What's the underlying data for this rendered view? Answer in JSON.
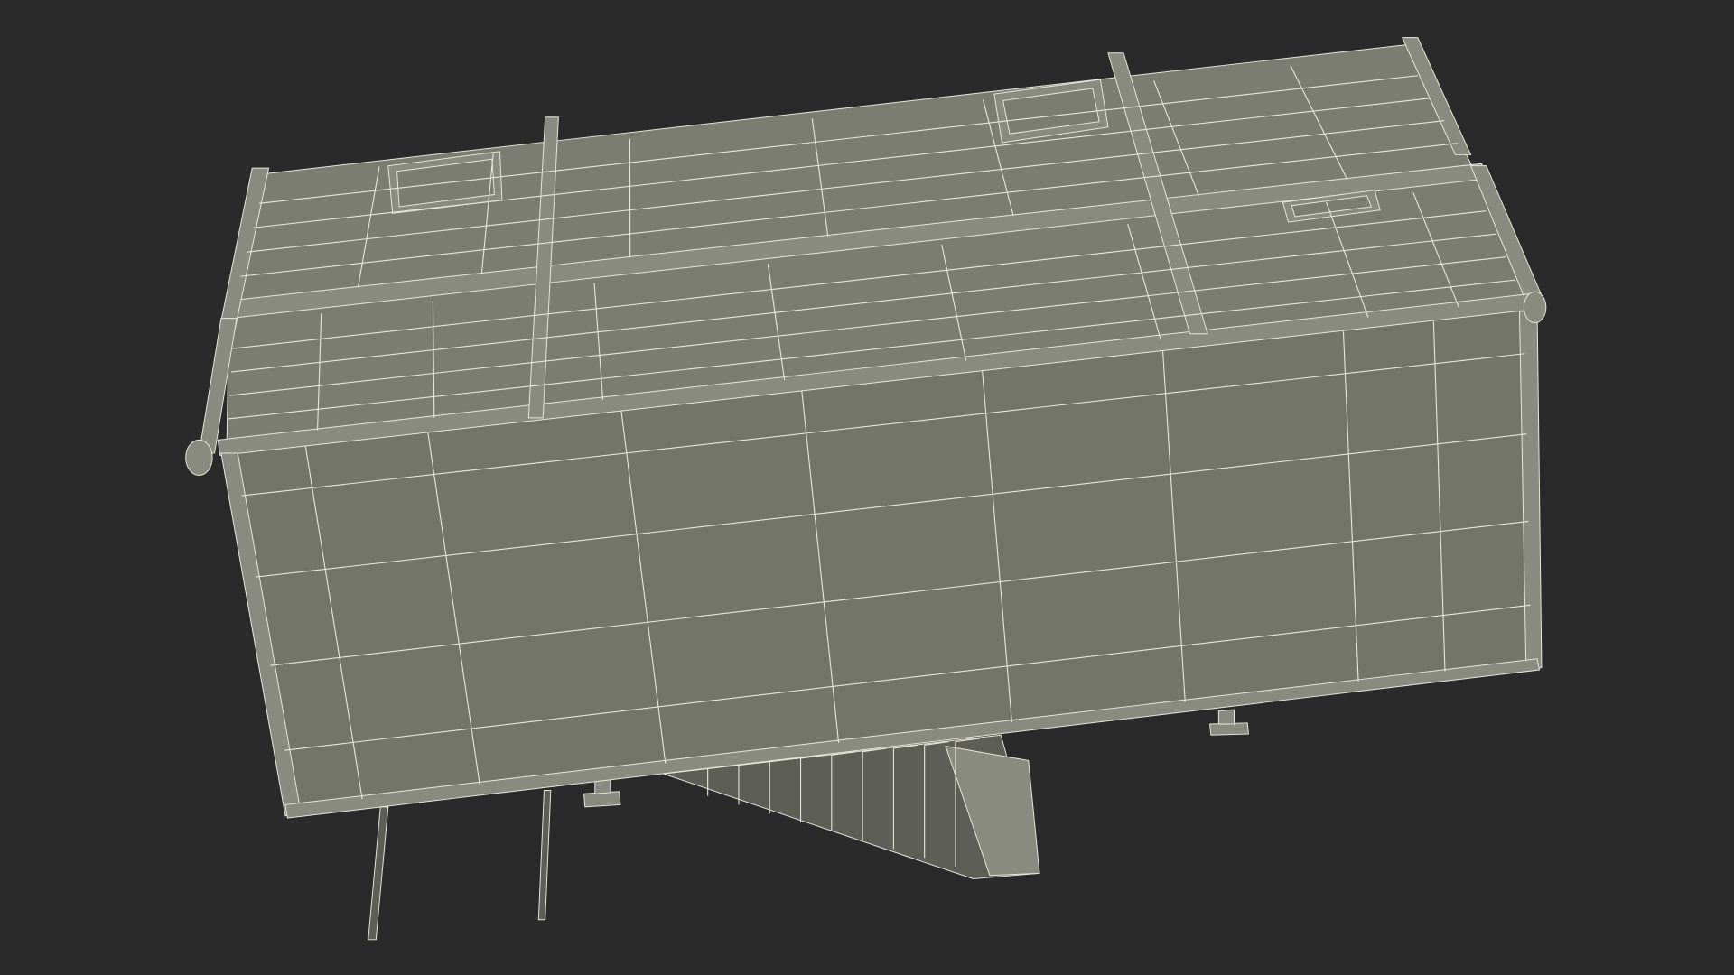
{
  "colors": {
    "background": "#2a2a2a",
    "roof_face": "#7b7c72",
    "front_face": "#73746a",
    "trim": "#8a8b80",
    "underside": "#5d5e55",
    "wire": "#e8e8da"
  }
}
